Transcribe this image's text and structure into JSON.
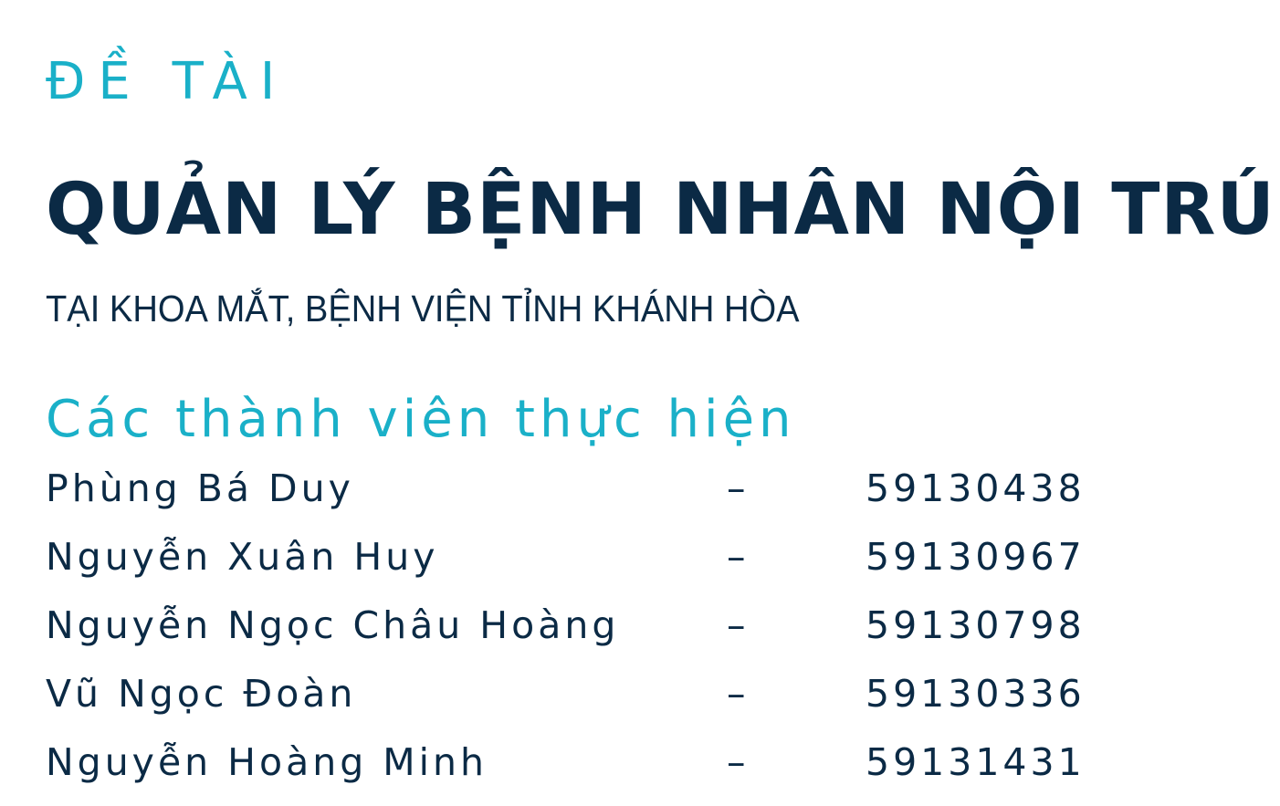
{
  "document": {
    "label": "ĐỀ TÀI",
    "title": "QUẢN LÝ BỆNH NHÂN NỘI TRÚ",
    "subtitle": "TẠI KHOA MẮT, BỆNH VIỆN TỈNH KHÁNH HÒA",
    "members_heading": "Các thành viên thực hiện",
    "members": [
      {
        "name": "Phùng Bá Duy",
        "separator": "–",
        "id": "59130438"
      },
      {
        "name": "Nguyễn Xuân Huy",
        "separator": "–",
        "id": "59130967"
      },
      {
        "name": "Nguyễn Ngọc Châu Hoàng",
        "separator": "–",
        "id": "59130798"
      },
      {
        "name": "Vũ Ngọc Đoàn",
        "separator": "–",
        "id": "59130336"
      },
      {
        "name": "Nguyễn Hoàng Minh",
        "separator": "–",
        "id": "59131431"
      }
    ]
  },
  "colors": {
    "accent": "#1ab0c8",
    "primary_text": "#0b2a45",
    "background": "#ffffff"
  }
}
